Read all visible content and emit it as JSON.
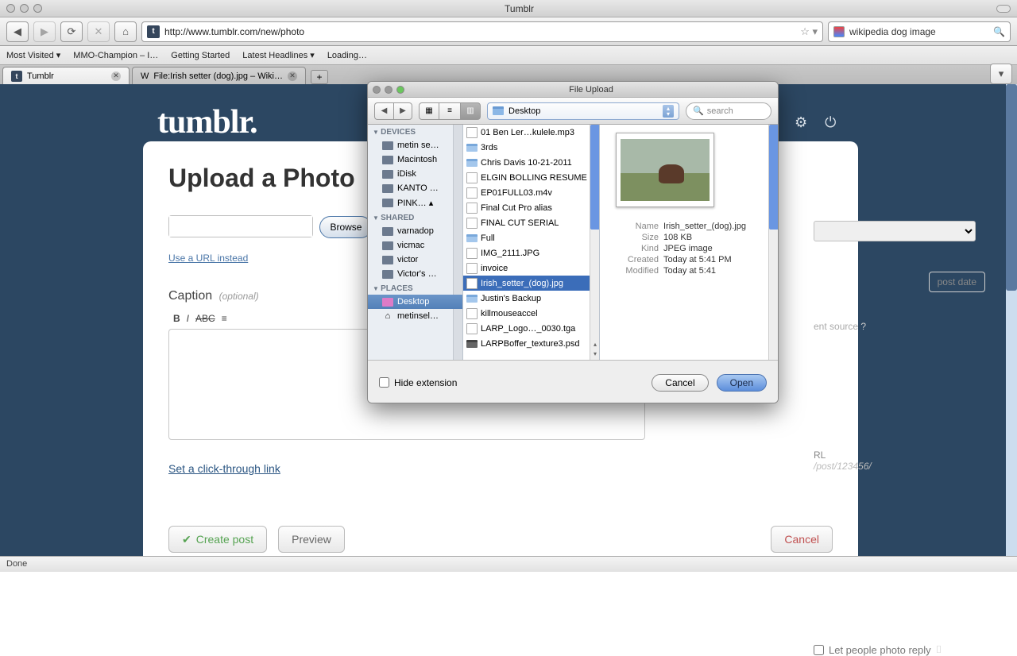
{
  "window": {
    "title": "Tumblr"
  },
  "toolbar": {
    "url": "http://www.tumblr.com/new/photo",
    "search_placeholder": "wikipedia dog image"
  },
  "bookmarks": [
    "Most Visited ▾",
    "MMO-Champion – I…",
    "Getting Started",
    "Latest Headlines ▾",
    "Loading…"
  ],
  "tabs": [
    {
      "label": "Tumblr",
      "active": true
    },
    {
      "label": "File:Irish setter (dog).jpg – Wiki…",
      "active": false
    }
  ],
  "page": {
    "logo": "tumblr.",
    "heading": "Upload a Photo",
    "browse": "Browse",
    "use_url": "Use a URL instead",
    "caption_label": "Caption",
    "optional": "(optional)",
    "click_link": "Set a click-through link",
    "create_post": "Create post",
    "preview": "Preview",
    "cancel": "Cancel",
    "post_date": "post date",
    "content_source": "ent source",
    "post_url_label": "RL",
    "post_url_path": "/post/123456/",
    "let_reply": "Let people photo reply"
  },
  "dialog": {
    "title": "File Upload",
    "location": "Desktop",
    "search_placeholder": "search",
    "sidebar": {
      "devices": {
        "label": "DEVICES",
        "items": [
          "metin se…",
          "Macintosh",
          "iDisk",
          "KANTO …",
          "PINK… ▴"
        ]
      },
      "shared": {
        "label": "SHARED",
        "items": [
          "varnadop",
          "vicmac",
          "victor",
          "Victor's …"
        ]
      },
      "places": {
        "label": "PLACES",
        "items": [
          "Desktop",
          "metinsel…"
        ]
      }
    },
    "files": [
      {
        "name": "01 Ben Ler…kulele.mp3",
        "type": "doc"
      },
      {
        "name": "3rds",
        "type": "fold",
        "children": true
      },
      {
        "name": "Chris Davis 10-21-2011",
        "type": "fold"
      },
      {
        "name": "ELGIN BOLLING RESUME",
        "type": "doc"
      },
      {
        "name": "EP01FULL03.m4v",
        "type": "doc"
      },
      {
        "name": "Final Cut Pro alias",
        "type": "doc"
      },
      {
        "name": "FINAL CUT SERIAL",
        "type": "doc"
      },
      {
        "name": "Full",
        "type": "fold",
        "children": true
      },
      {
        "name": "IMG_2111.JPG",
        "type": "doc"
      },
      {
        "name": "invoice",
        "type": "doc"
      },
      {
        "name": "Irish_setter_(dog).jpg",
        "type": "doc",
        "selected": true
      },
      {
        "name": "Justin's Backup",
        "type": "fold",
        "children": true
      },
      {
        "name": "killmouseaccel",
        "type": "doc"
      },
      {
        "name": "LARP_Logo…_0030.tga",
        "type": "doc"
      },
      {
        "name": "LARPBoffer_texture3.psd",
        "type": "fold-dark"
      }
    ],
    "preview": {
      "name_label": "Name",
      "name_value": "Irish_setter_(dog).jpg",
      "size_label": "Size",
      "size_value": "108 KB",
      "kind_label": "Kind",
      "kind_value": "JPEG image",
      "created_label": "Created",
      "created_value": "Today at 5:41 PM",
      "modified_label": "Modified",
      "modified_value": "Today at 5:41"
    },
    "hide_ext": "Hide extension",
    "cancel": "Cancel",
    "open": "Open"
  },
  "status": "Done"
}
